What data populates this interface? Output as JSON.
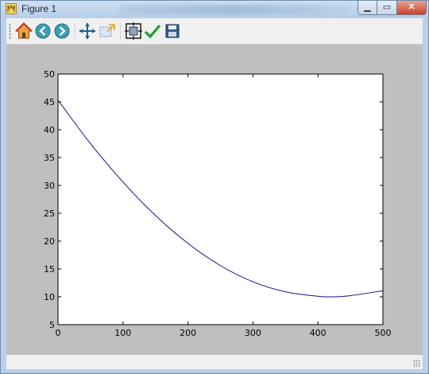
{
  "window": {
    "title": "Figure 1",
    "minimize_glyph": "▁",
    "maximize_glyph": "▭",
    "close_glyph": "✕"
  },
  "toolbar": {
    "buttons": [
      {
        "name": "home",
        "icon": "home-icon"
      },
      {
        "name": "back",
        "icon": "back-arrow-icon"
      },
      {
        "name": "forward",
        "icon": "forward-arrow-icon"
      },
      {
        "name": "pan",
        "icon": "pan-move-icon"
      },
      {
        "name": "zoom",
        "icon": "zoom-rect-icon"
      },
      {
        "name": "subplots",
        "icon": "subplots-configure-icon"
      },
      {
        "name": "edit",
        "icon": "checkmark-icon"
      },
      {
        "name": "save",
        "icon": "floppy-disk-icon"
      }
    ]
  },
  "colors": {
    "line": "#2b2b8c",
    "canvas_bg": "#bfbfbf",
    "axes_bg": "#ffffff"
  },
  "chart_data": {
    "type": "line",
    "xlim": [
      0,
      500
    ],
    "ylim": [
      5,
      50
    ],
    "xticks": [
      "0",
      "100",
      "200",
      "300",
      "400",
      "500"
    ],
    "yticks": [
      "5",
      "10",
      "15",
      "20",
      "25",
      "30",
      "35",
      "40",
      "45",
      "50"
    ],
    "grid": false,
    "series": [
      {
        "x": [
          0,
          50,
          100,
          150,
          200,
          250,
          300,
          350,
          400,
          425,
          450,
          500
        ],
        "y": [
          45.3,
          37.5,
          30.6,
          24.6,
          19.6,
          15.6,
          12.7,
          10.9,
          10.1,
          10.0,
          10.2,
          11.1
        ]
      }
    ]
  }
}
